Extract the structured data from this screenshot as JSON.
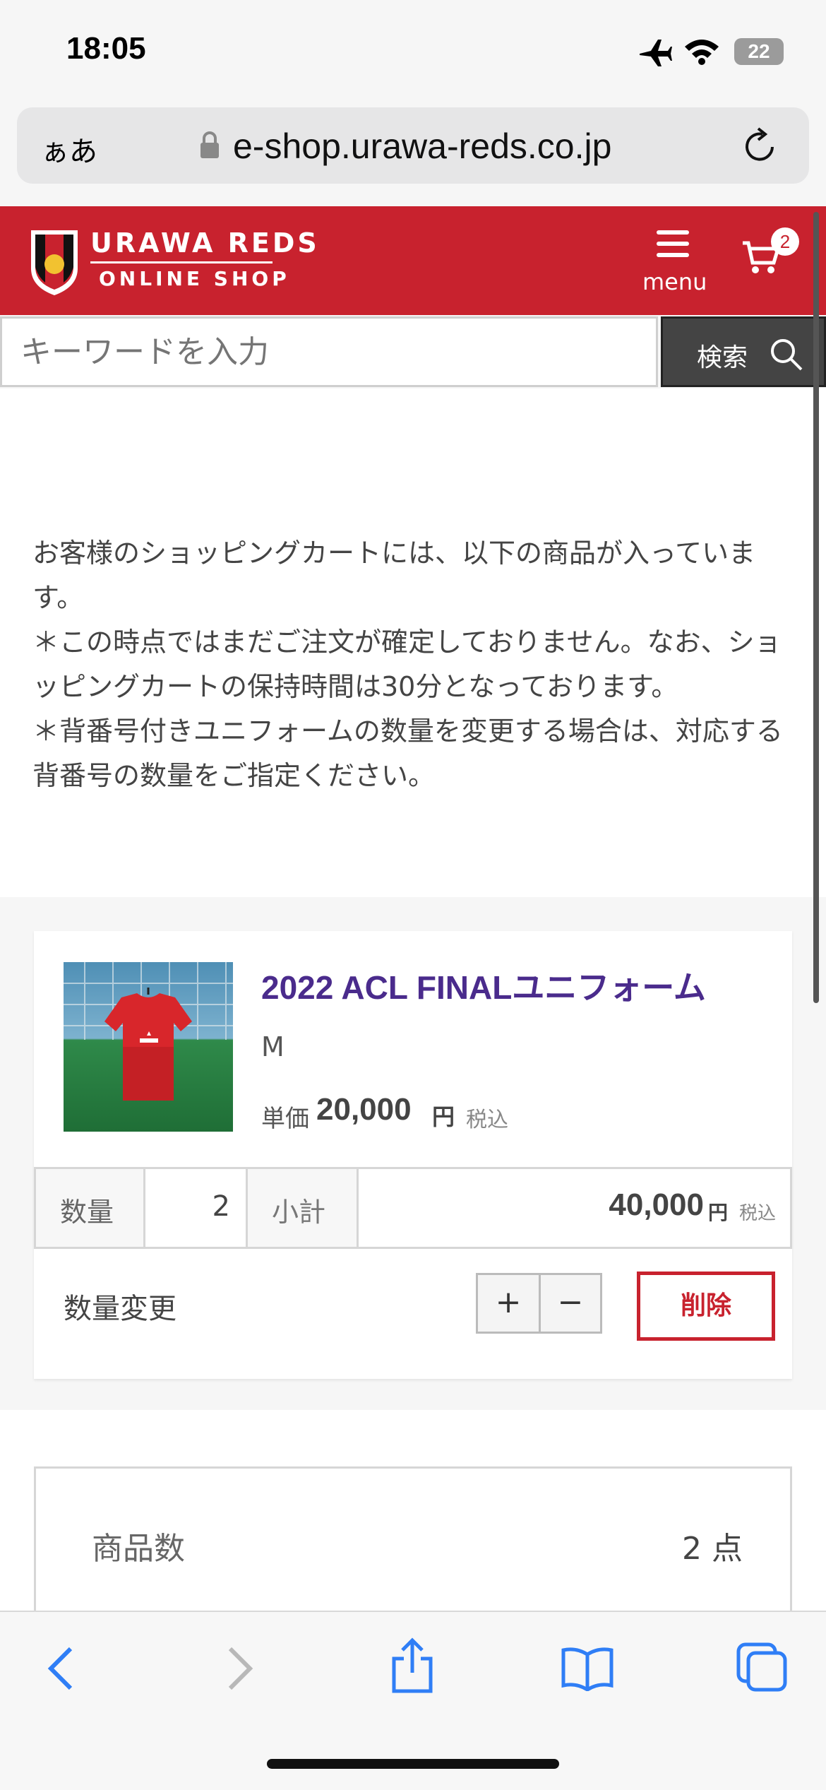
{
  "status_bar": {
    "time": "18:05",
    "battery": "22"
  },
  "browser": {
    "aa_label": "ぁあ",
    "url": "e-shop.urawa-reds.co.jp"
  },
  "header": {
    "logo_line1": "URAWA REDS",
    "logo_line2": "ONLINE SHOP",
    "menu_label": "menu",
    "cart_count": "2",
    "accent_color": "#c8222e"
  },
  "search": {
    "placeholder": "キーワードを入力",
    "button_label": "検索"
  },
  "notice": {
    "line1": "お客様のショッピングカートには、以下の商品が入っています。",
    "line2": "＊この時点ではまだご注文が確定しておりません。なお、ショッピングカートの保持時間は30分となっております。",
    "line3": "＊背番号付きユニフォームの数量を変更する場合は、対応する背番号の数量をご指定ください。"
  },
  "cart_item": {
    "name": "2022 ACL FINALユニフォーム",
    "size": "M",
    "unit_price_label": "単価",
    "unit_price": "20,000",
    "yen": "円",
    "tax_label": "税込",
    "quantity_label": "数量",
    "quantity": "2",
    "subtotal_label": "小計",
    "subtotal": "40,000",
    "change_qty_label": "数量変更",
    "plus": "+",
    "minus": "−",
    "delete_label": "削除"
  },
  "summary": {
    "item_count_label": "商品数",
    "item_count": "2 点"
  }
}
